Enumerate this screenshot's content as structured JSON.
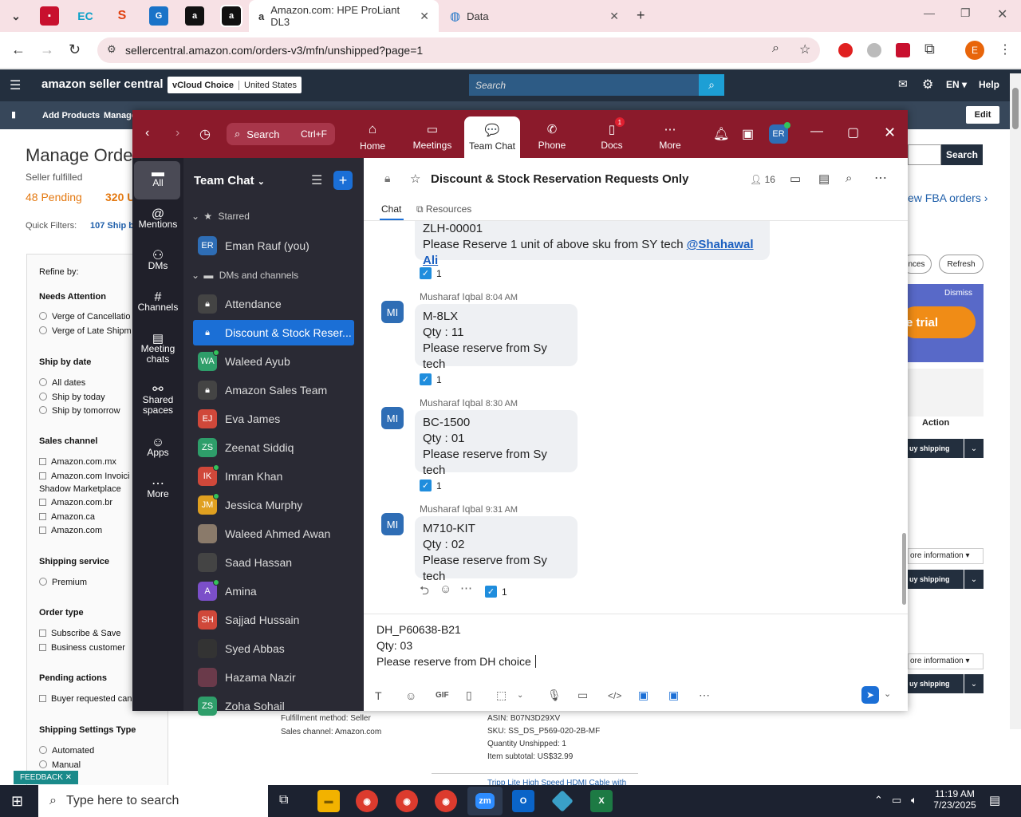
{
  "browser": {
    "tab1": "Amazon.com: HPE ProLiant DL3",
    "tab2": "Data",
    "url": "sellercentral.amazon.com/orders-v3/mfn/unshipped?page=1",
    "profile": "E"
  },
  "amazon": {
    "logo": "amazon seller central",
    "store": "vCloud Choice",
    "country": "United States",
    "search_placeholder": "Search",
    "lang": "EN",
    "help": "Help",
    "nav": [
      "Add Products",
      "Manage"
    ],
    "edit": "Edit",
    "title": "Manage Orde",
    "subtitle": "Seller fulfilled",
    "pending": "48 Pending",
    "unshipped": "320 U",
    "quick_filters": "Quick Filters:",
    "quick_ship": "107 Ship b",
    "search_btn": "Search",
    "fba_link": "ew FBA orders ›",
    "refine": "Refine by:",
    "needs_attention": "Needs Attention",
    "na_items": [
      "Verge of Cancellatio",
      "Verge of Late Shipm"
    ],
    "ship_by": "Ship by date",
    "ship_items": [
      "All dates",
      "Ship by today",
      "Ship by tomorrow"
    ],
    "sales_channel": "Sales channel",
    "sc_items": [
      "Amazon.com.mx",
      "Amazon.com Invoici",
      "Shadow Marketplace",
      "Amazon.com.br",
      "Amazon.ca",
      "Amazon.com"
    ],
    "shipping_service": "Shipping service",
    "ss_items": [
      "Premium"
    ],
    "order_type": "Order type",
    "ot_items": [
      "Subscribe & Save",
      "Business customer"
    ],
    "pending_actions": "Pending actions",
    "pa_items": [
      "Buyer requested can"
    ],
    "ship_settings": "Shipping Settings Type",
    "sst_items": [
      "Automated",
      "Manual"
    ],
    "refresh": "Refresh",
    "ences": "nces",
    "dismiss": "Dismiss",
    "trial": "e trial",
    "action": "Action",
    "buy_shipping": "uy shipping",
    "more_info": "ore information",
    "fulfillment": "Fulfillment method: Seller",
    "channel": "Sales channel: Amazon.com",
    "asin": "ASIN: B07N3D29XV",
    "sku": "SKU: SS_DS_P569-020-2B-MF",
    "qty_unshipped": "Quantity Unshipped: 1",
    "subtotal": "Item subtotal: US$32.99",
    "feedback": "FEEDBACK ✕",
    "product": "Tripp Lite High Speed HDMI Cable with"
  },
  "zoom": {
    "search": "Search",
    "shortcut": "Ctrl+F",
    "nav": [
      {
        "label": "Home"
      },
      {
        "label": "Meetings"
      },
      {
        "label": "Team Chat"
      },
      {
        "label": "Phone"
      },
      {
        "label": "Docs",
        "badge": "1"
      },
      {
        "label": "More"
      }
    ],
    "avatar": "ER",
    "rail": [
      "All",
      "Mentions",
      "DMs",
      "Channels",
      "Meeting chats",
      "Shared spaces",
      "Apps",
      "More"
    ],
    "sidebar_title": "Team Chat",
    "starred": "Starred",
    "dms_channels": "DMs and channels",
    "starred_items": [
      {
        "initials": "ER",
        "name": "Eman Rauf (you)",
        "color": "#2e6db5"
      }
    ],
    "channels": [
      {
        "initials": "",
        "name": "Attendance",
        "color": "#555",
        "lock": true
      },
      {
        "initials": "",
        "name": "Discount & Stock Reser...",
        "color": "#1b6fd6",
        "lock": true,
        "sel": true
      },
      {
        "initials": "WA",
        "name": "Waleed Ayub",
        "color": "#2e9e6a",
        "online": true
      },
      {
        "initials": "",
        "name": "Amazon Sales Team",
        "color": "#555",
        "lock": true
      },
      {
        "initials": "EJ",
        "name": "Eva James",
        "color": "#d0483a"
      },
      {
        "initials": "ZS",
        "name": "Zeenat Siddiq",
        "color": "#2e9e6a"
      },
      {
        "initials": "IK",
        "name": "Imran Khan",
        "color": "#d0483a",
        "online": true
      },
      {
        "initials": "JM",
        "name": "Jessica Murphy",
        "color": "#e0a020",
        "online": true
      },
      {
        "initials": "",
        "name": "Waleed Ahmed Awan",
        "color": "#8a7a6a"
      },
      {
        "initials": "",
        "name": "Saad Hassan",
        "color": "#444"
      },
      {
        "initials": "A",
        "name": "Amina",
        "color": "#7b4fc9",
        "online": true
      },
      {
        "initials": "SH",
        "name": "Sajjad Hussain",
        "color": "#d0483a"
      },
      {
        "initials": "",
        "name": "Syed Abbas",
        "color": "#333"
      },
      {
        "initials": "",
        "name": "Hazama Nazir",
        "color": "#6a3a4a"
      },
      {
        "initials": "ZS",
        "name": "Zoha Sohail",
        "color": "#2e9e6a"
      }
    ],
    "channel_title": "Discount & Stock Reservation Requests Only",
    "members": "16",
    "tabs": [
      "Chat",
      "Resources"
    ],
    "first_msg": {
      "lines": [
        "ZLH-00001",
        "Please Reserve 1 unit of above sku from SY tech "
      ],
      "mention": "@Shahawal Ali",
      "reaction": "1"
    },
    "messages": [
      {
        "sender": "Musharaf Iqbal",
        "time": "8:04 AM",
        "lines": [
          "M-8LX",
          "Qty : 11",
          "Please reserve from Sy tech"
        ],
        "reaction": "1"
      },
      {
        "sender": "Musharaf Iqbal",
        "time": "8:30 AM",
        "lines": [
          "BC-1500",
          "Qty : 01",
          "Please reserve from Sy tech"
        ],
        "reaction": "1"
      },
      {
        "sender": "Musharaf Iqbal",
        "time": "9:31 AM",
        "lines": [
          "M710-KIT",
          "Qty : 02",
          "Please reserve from Sy tech"
        ],
        "reaction": "1"
      }
    ],
    "mi": "MI",
    "compose": [
      "DH_P60638-B21",
      "Qty: 03",
      "Please reserve from DH choice "
    ]
  },
  "taskbar": {
    "search": "Type here to search",
    "time": "11:19 AM",
    "date": "7/23/2025"
  }
}
